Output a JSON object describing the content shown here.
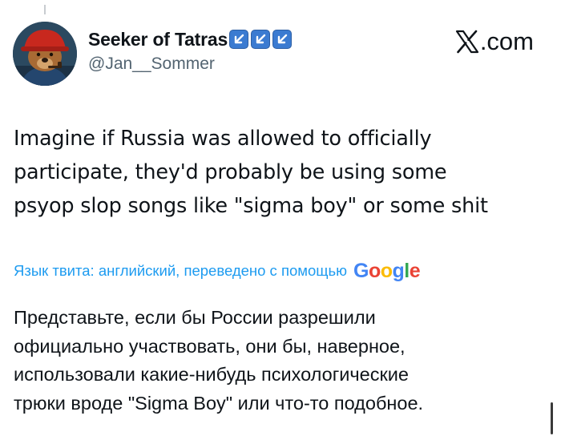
{
  "author": {
    "display_name": "Seeker of Tatras",
    "handle": "@Jan__Sommer",
    "badge_icons": [
      "arrow-down-left-icon",
      "arrow-down-left-icon",
      "arrow-down-left-icon"
    ]
  },
  "brand": {
    "text": ".com",
    "icon": "x-logo-icon"
  },
  "tweet": {
    "text": "Imagine if Russia was allowed to officially\nparticipate, they'd probably be using some\npsyop slop songs like \"sigma boy\" or some shit"
  },
  "translation": {
    "notice": "Язык твита: английский, переведено с помощью",
    "provider": "Google",
    "text": "Представьте, если бы России разрешили\nофициально участвовать, они бы, наверное,\nиспользовали какие-нибудь психологические\nтрюки вроде \"Sigma Boy\" или что-то подобное."
  },
  "colors": {
    "link_blue": "#1d9bf0",
    "secondary_gray": "#536471",
    "badge_blue": "#3b7bd1"
  }
}
